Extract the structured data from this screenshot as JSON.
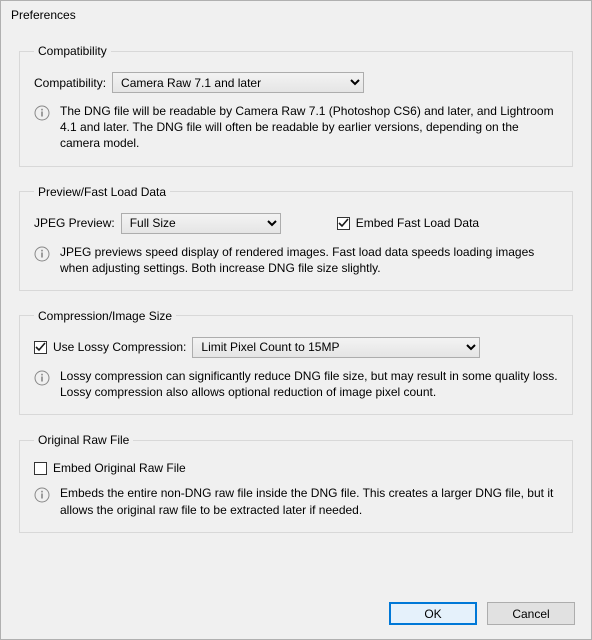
{
  "window_title": "Preferences",
  "groups": {
    "compatibility": {
      "legend": "Compatibility",
      "label": "Compatibility:",
      "value": "Camera Raw 7.1 and later",
      "info": "The DNG file will be readable by Camera Raw 7.1 (Photoshop CS6) and later, and Lightroom 4.1 and later. The DNG file will often be readable by earlier versions, depending on the camera model."
    },
    "preview": {
      "legend": "Preview/Fast Load Data",
      "label": "JPEG Preview:",
      "value": "Full Size",
      "embed_fast_load_label": "Embed Fast Load Data",
      "embed_fast_load_checked": true,
      "info": "JPEG previews speed display of rendered images.  Fast load data speeds loading images when adjusting settings.  Both increase DNG file size slightly."
    },
    "compression": {
      "legend": "Compression/Image Size",
      "use_lossy_label": "Use Lossy Compression:",
      "use_lossy_checked": true,
      "limit_value": "Limit Pixel Count to 15MP",
      "info": "Lossy compression can significantly reduce DNG file size, but may result in some quality loss.  Lossy compression also allows optional reduction of image pixel count."
    },
    "original": {
      "legend": "Original Raw File",
      "embed_label": "Embed Original Raw File",
      "embed_checked": false,
      "info": "Embeds the entire non-DNG raw file inside the DNG file.  This creates a larger DNG file, but it allows the original raw file to be extracted later if needed."
    }
  },
  "buttons": {
    "ok": "OK",
    "cancel": "Cancel"
  }
}
